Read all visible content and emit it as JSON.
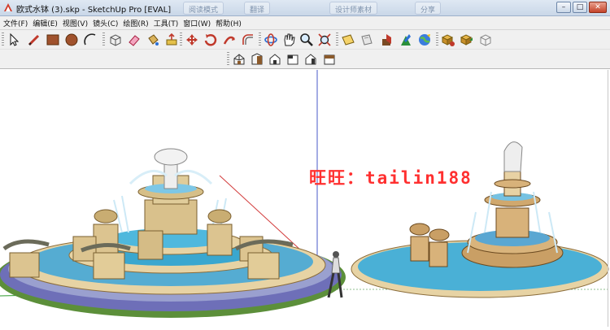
{
  "window": {
    "title": "欧式水钵 (3).skp - SketchUp Pro [EVAL]",
    "ghost_tabs": [
      "阅读模式",
      "翻译",
      "设计师素材",
      "分享",
      "..."
    ],
    "controls": {
      "minimize": "–",
      "maximize": "□",
      "close": "✕"
    }
  },
  "menu": {
    "items": [
      "文件(F)",
      "编辑(E)",
      "视图(V)",
      "镜头(C)",
      "绘图(R)",
      "工具(T)",
      "窗口(W)",
      "帮助(H)"
    ]
  },
  "toolbar_main": {
    "icons": [
      "select-icon",
      "line-pencil-icon",
      "rectangle-icon",
      "circle-icon",
      "arc-icon",
      "make-component-icon",
      "eraser-icon",
      "paint-bucket-icon",
      "push-pull-icon",
      "move-icon",
      "rotate-icon",
      "follow-me-icon",
      "offset-icon",
      "orbit-icon",
      "pan-icon",
      "zoom-icon",
      "zoom-extents-icon",
      "section-plane-icon",
      "iso-view-icon",
      "add-location-icon",
      "google-earth-icon",
      "photo-texture-icon",
      "get-models-icon",
      "share-model-icon",
      "extension-icon"
    ]
  },
  "toolbar_views": {
    "icons": [
      "iso-view-icon",
      "top-view-icon",
      "front-view-icon",
      "right-view-icon",
      "back-view-icon",
      "left-view-icon"
    ]
  },
  "viewport": {
    "watermark": "旺旺：tailin188",
    "colors": {
      "pool_water": "#5ab6d8",
      "stone": "#e7d3a4",
      "grass": "#5a9a3a",
      "paving": "#6f6fb5",
      "watermark": "#ff3030"
    }
  }
}
